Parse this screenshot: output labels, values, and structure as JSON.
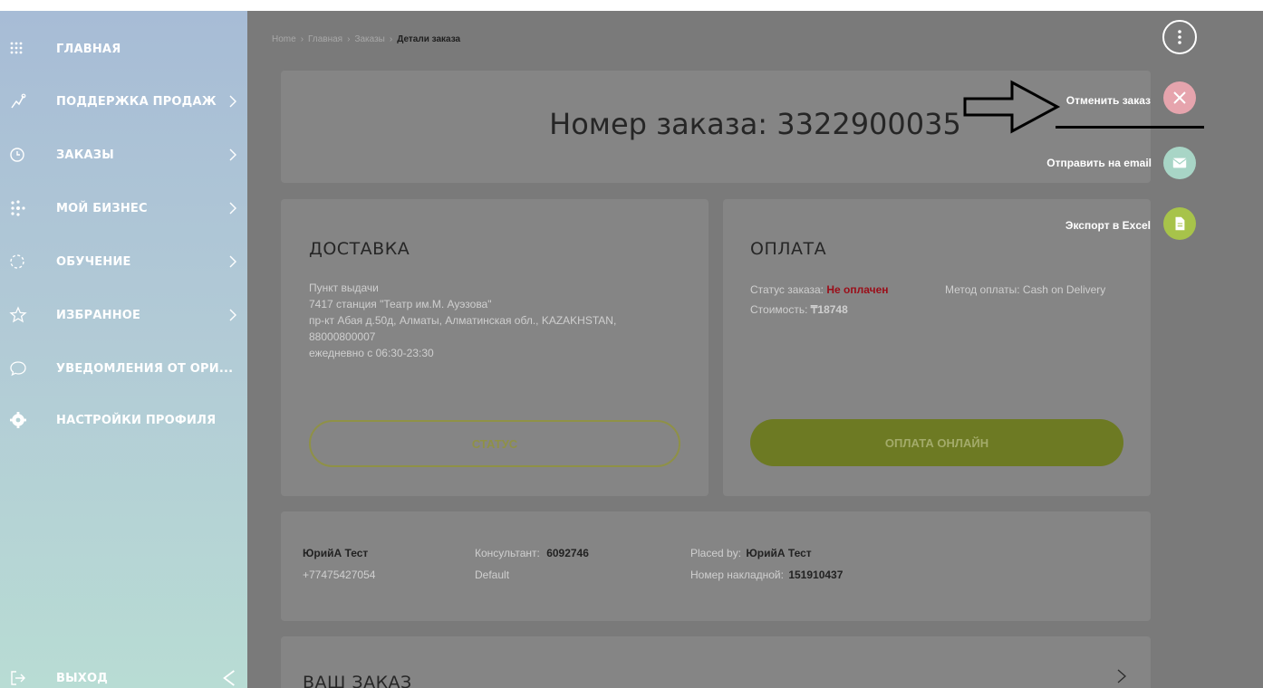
{
  "sidebar": {
    "items": [
      {
        "label": "ГЛАВНАЯ",
        "icon": "grid-icon"
      },
      {
        "label": "ПОДДЕРЖКА ПРОДАЖ",
        "icon": "chart-icon"
      },
      {
        "label": "ЗАКАЗЫ",
        "icon": "clock-icon"
      },
      {
        "label": "МОЙ БИЗНЕС",
        "icon": "network-icon"
      },
      {
        "label": "ОБУЧЕНИЕ",
        "icon": "circle-dots-icon"
      },
      {
        "label": "ИЗБРАННОЕ",
        "icon": "star-icon"
      },
      {
        "label": "УВЕДОМЛЕНИЯ ОТ ОРИ...",
        "icon": "chat-icon"
      },
      {
        "label": "НАСТРОЙКИ ПРОФИЛЯ",
        "icon": "gear-icon"
      }
    ],
    "logout_label": "ВЫХОД"
  },
  "breadcrumb": {
    "items": [
      "Home",
      "Главная",
      "Заказы"
    ],
    "current": "Детали заказа"
  },
  "order": {
    "title": "Номер заказа: 3322900035"
  },
  "delivery": {
    "title": "ДОСТАВКА",
    "lines": [
      "Пункт выдачи",
      "7417 станция \"Театр им.М. Ауэзова\"",
      "пр-кт Абая д.50д, Алматы, Алматинская обл., KAZAKHSTAN,",
      "88000800007",
      "ежедневно с 06:30-23:30"
    ],
    "status_button": "СТАТУС"
  },
  "payment": {
    "title": "ОПЛАТА",
    "status_label": "Статус заказа:",
    "status_value": "Не оплачен",
    "method_label": "Метод оплаты:",
    "method_value": "Cash on Delivery",
    "cost_label": "Стоимость:",
    "cost_value": "₸18748",
    "pay_button": "ОПЛАТА ОНЛАЙН"
  },
  "customer": {
    "name": "ЮрийА Тест",
    "phone": "+77475427054",
    "consultant_label": "Консультант:",
    "consultant_value": "6092746",
    "consultant_sub": "Default",
    "placed_by_label": "Placed by:",
    "placed_by_value": "ЮрийА Тест",
    "waybill_label": "Номер накладной:",
    "waybill_value": "151910437"
  },
  "your_order": {
    "title": "ВАШ ЗАКАЗ"
  },
  "actions": {
    "menu_icon": "more-vertical-icon",
    "items": [
      {
        "label": "Отменить заказ",
        "icon": "close-icon",
        "color": "#e6a4ad"
      },
      {
        "label": "Отправить на email",
        "icon": "mail-icon",
        "color": "#a8d5c6"
      },
      {
        "label": "Экспорт в Excel",
        "icon": "document-icon",
        "color": "#a7c34a"
      }
    ]
  },
  "colors": {
    "accent_olive": "#8f9146",
    "unpaid_red": "#b0001a",
    "overlay": "#7a7a7a"
  }
}
